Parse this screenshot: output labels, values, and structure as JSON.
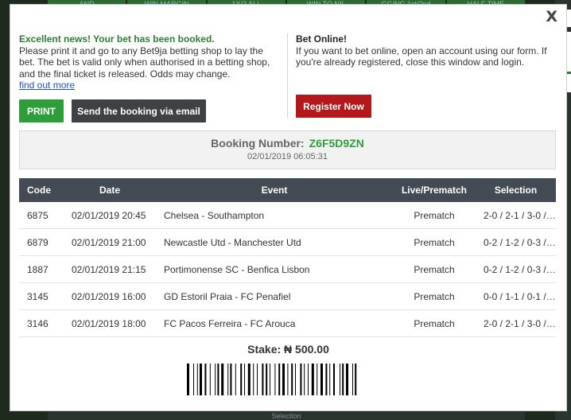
{
  "background": {
    "tabs": [
      "AND",
      "WIN MARGIN",
      "1X/2 ALL",
      "WIN TO NIL",
      "GG/NG 1st/2nd",
      "HALF TIME"
    ],
    "bottom_text": "Selection"
  },
  "modal": {
    "close_symbol": "X",
    "success_title": "Excellent news! Your bet has been booked.",
    "success_body": "Please print it and go to any Bet9ja betting shop to lay the bet. The bet is valid only when authorised in a betting shop, and the final ticket is released. Odds may change.",
    "find_out_more": "find out more",
    "print_label": "PRINT",
    "email_label": "Send the booking via email",
    "online_title": "Bet Online!",
    "online_body": "If you want to bet online, open an account using our form. If you're already registered, close this window and login.",
    "register_label": "Register Now",
    "booking_label": "Booking Number:",
    "booking_number": "Z6F5D9ZN",
    "booking_datetime": "02/01/2019 06:05:31",
    "table": {
      "headers": {
        "code": "Code",
        "date": "Date",
        "event": "Event",
        "live": "Live/Prematch",
        "selection": "Selection"
      },
      "rows": [
        {
          "code": "6875",
          "date": "02/01/2019 20:45",
          "event": "Chelsea - Southampton",
          "live": "Prematch",
          "selection": "2-0 / 2-1 / 3-0 / 3..."
        },
        {
          "code": "6879",
          "date": "02/01/2019 21:00",
          "event": "Newcastle Utd - Manchester Utd",
          "live": "Prematch",
          "selection": "0-2 / 1-2 / 0-3 / 1..."
        },
        {
          "code": "1887",
          "date": "02/01/2019 21:15",
          "event": "Portimonense SC - Benfica Lisbon",
          "live": "Prematch",
          "selection": "0-2 / 1-2 / 0-3 / 1..."
        },
        {
          "code": "3145",
          "date": "02/01/2019 16:00",
          "event": "GD Estoril Praia - FC Penafiel",
          "live": "Prematch",
          "selection": "0-0 / 1-1 / 0-1 / 1..."
        },
        {
          "code": "3146",
          "date": "02/01/2019 18:00",
          "event": "FC Pacos Ferreira - FC Arouca",
          "live": "Prematch",
          "selection": "2-0 / 2-1 / 3-0 / 3..."
        }
      ]
    },
    "stake": "Stake: ₦ 500.00"
  },
  "colors": {
    "success_green": "#2e9e3b",
    "register_red": "#b3191b",
    "table_header": "#444b55"
  }
}
